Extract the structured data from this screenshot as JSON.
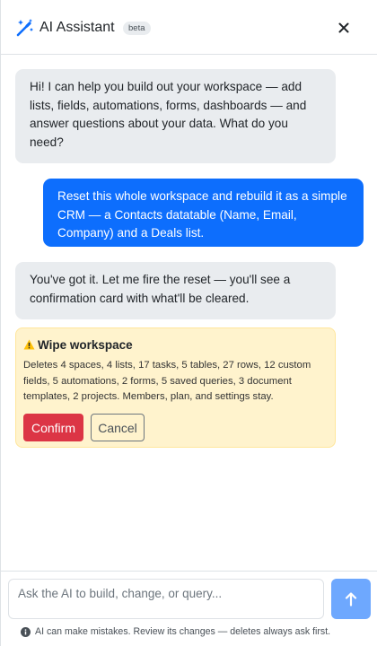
{
  "header": {
    "title": "AI Assistant",
    "badge": "beta",
    "icon": "magic-wand-icon",
    "close_icon": "close-icon"
  },
  "messages": [
    {
      "role": "assistant",
      "text": "Hi! I can help you build out your workspace — add lists, fields, automations, forms, dashboards — and answer questions about your data. What do you need?"
    },
    {
      "role": "user",
      "text": "Reset this whole workspace and rebuild it as a simple CRM — a Contacts datatable (Name, Email, Company) and a Deals list."
    },
    {
      "role": "assistant",
      "text": "You've got it. Let me fire the reset — you'll see a confirmation card with what'll be cleared."
    }
  ],
  "confirm_card": {
    "title": "Wipe workspace",
    "icon": "warning-icon",
    "description": "Deletes 4 spaces, 4 lists, 17 tasks, 5 tables, 27 rows, 12 custom fields, 5 automations, 2 forms, 5 saved queries, 3 document templates, 2 projects. Members, plan, and settings stay.",
    "confirm_label": "Confirm",
    "cancel_label": "Cancel"
  },
  "composer": {
    "placeholder": "Ask the AI to build, change, or query...",
    "send_icon": "arrow-up-icon",
    "disclaimer": "AI can make mistakes. Review its changes — deletes always ask first.",
    "info_icon": "info-icon"
  },
  "colors": {
    "accent": "#0d6efd",
    "send_disabled": "#6ea8fe",
    "danger": "#dc3545",
    "warning_bg": "#fff3cd"
  }
}
